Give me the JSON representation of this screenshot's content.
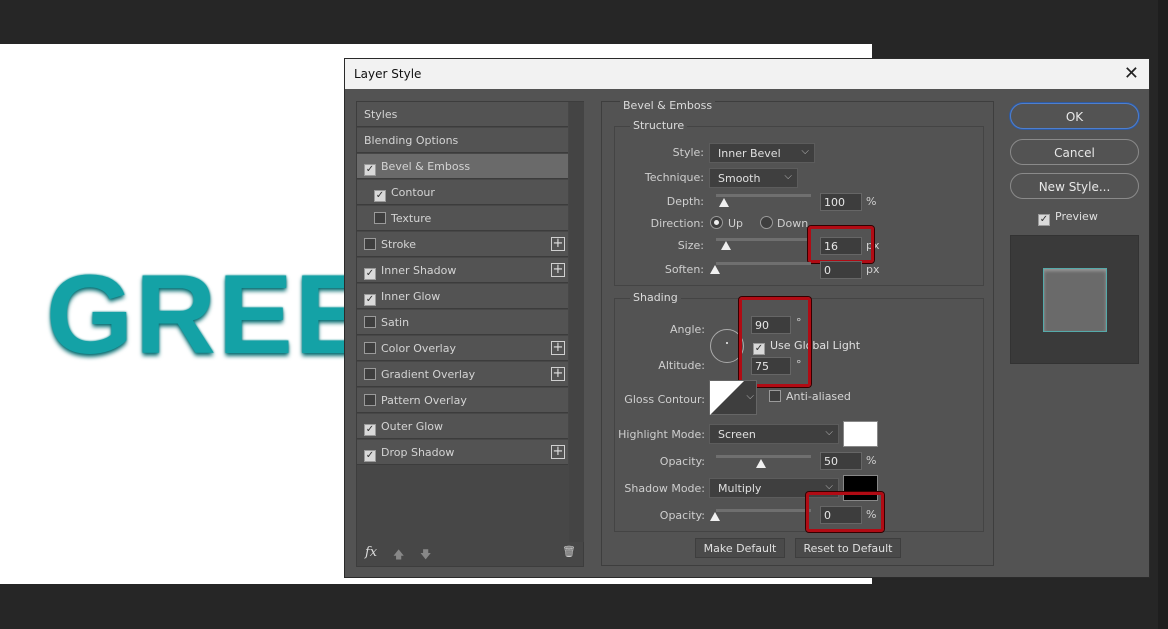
{
  "canvas": {
    "text": "GREEN",
    "text_color": "#14a2a6"
  },
  "dialog": {
    "title": "Layer Style",
    "styles_list": {
      "header": "Styles",
      "blending": "Blending Options",
      "items": [
        {
          "label": "Bevel & Emboss",
          "checked": true,
          "selected": true,
          "plus": false
        },
        {
          "label": "Contour",
          "checked": true,
          "sub": true,
          "plus": false
        },
        {
          "label": "Texture",
          "checked": false,
          "sub": true,
          "plus": false
        },
        {
          "label": "Stroke",
          "checked": false,
          "plus": true
        },
        {
          "label": "Inner Shadow",
          "checked": true,
          "plus": true
        },
        {
          "label": "Inner Glow",
          "checked": true,
          "plus": false
        },
        {
          "label": "Satin",
          "checked": false,
          "plus": false
        },
        {
          "label": "Color Overlay",
          "checked": false,
          "plus": true
        },
        {
          "label": "Gradient Overlay",
          "checked": false,
          "plus": true
        },
        {
          "label": "Pattern Overlay",
          "checked": false,
          "plus": false
        },
        {
          "label": "Outer Glow",
          "checked": true,
          "plus": false
        },
        {
          "label": "Drop Shadow",
          "checked": true,
          "plus": true
        }
      ],
      "fx": "fx"
    },
    "bevel": {
      "title": "Bevel & Emboss",
      "structure": {
        "title": "Structure",
        "style_label": "Style:",
        "style": "Inner Bevel",
        "technique_label": "Technique:",
        "technique": "Smooth",
        "depth_label": "Depth:",
        "depth": "100",
        "depth_unit": "%",
        "direction_label": "Direction:",
        "up": "Up",
        "down": "Down",
        "direction": "Up",
        "size_label": "Size:",
        "size": "16",
        "size_unit": "px",
        "soften_label": "Soften:",
        "soften": "0",
        "soften_unit": "px"
      },
      "shading": {
        "title": "Shading",
        "angle_label": "Angle:",
        "angle": "90",
        "deg": "°",
        "global_light": "Use Global Light",
        "global_light_checked": true,
        "altitude_label": "Altitude:",
        "altitude": "75",
        "gloss_label": "Gloss Contour:",
        "anti_aliased": "Anti-aliased",
        "anti_aliased_checked": false,
        "highlight_label": "Highlight Mode:",
        "highlight_mode": "Screen",
        "highlight_color": "#ffffff",
        "opacity_label": "Opacity:",
        "highlight_opacity": "50",
        "pct": "%",
        "shadow_label": "Shadow Mode:",
        "shadow_mode": "Multiply",
        "shadow_color": "#000000",
        "shadow_opacity": "0"
      },
      "make_default": "Make Default",
      "reset_default": "Reset to Default"
    },
    "buttons": {
      "ok": "OK",
      "cancel": "Cancel",
      "new_style": "New Style...",
      "preview": "Preview",
      "preview_checked": true
    },
    "highlight_color": "#b10b14"
  }
}
